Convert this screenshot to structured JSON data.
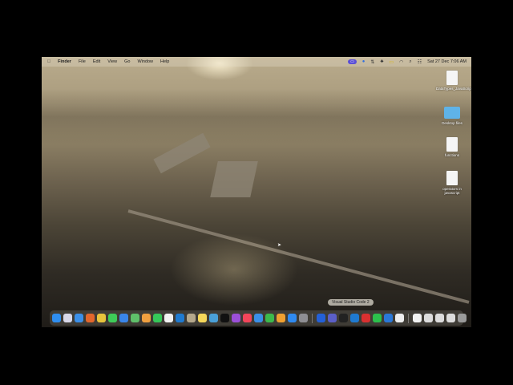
{
  "menubar": {
    "app": "Finder",
    "items": [
      "File",
      "Edit",
      "View",
      "Go",
      "Window",
      "Help"
    ],
    "clock": "Sat 27 Dec  7:06 AM"
  },
  "desktop_icons": [
    {
      "label": "DataTypes_JavaScript_Uhl..._Academy",
      "type": "document"
    },
    {
      "label": "Desktop files",
      "type": "folder"
    },
    {
      "label": "functions",
      "type": "document"
    },
    {
      "label": "operators in javascript",
      "type": "document"
    }
  ],
  "dock": {
    "tooltip": "Visual Studio Code 2",
    "apps": [
      {
        "name": "finder",
        "color": "#2f8ef0"
      },
      {
        "name": "launchpad",
        "color": "#d8d8e8"
      },
      {
        "name": "safari",
        "color": "#3b8fe8"
      },
      {
        "name": "firefox",
        "color": "#e2662c"
      },
      {
        "name": "chrome",
        "color": "#e7c33c"
      },
      {
        "name": "messages",
        "color": "#3ecb58"
      },
      {
        "name": "mail",
        "color": "#3a86ea"
      },
      {
        "name": "maps",
        "color": "#5fbf6a"
      },
      {
        "name": "photos",
        "color": "#f0a040"
      },
      {
        "name": "facetime",
        "color": "#35c759"
      },
      {
        "name": "reminders",
        "color": "#f2f2f2"
      },
      {
        "name": "vscode",
        "color": "#1f7ad0"
      },
      {
        "name": "contacts",
        "color": "#b5a88c"
      },
      {
        "name": "notes",
        "color": "#f5d75a"
      },
      {
        "name": "preview",
        "color": "#4aa0d8"
      },
      {
        "name": "apple-tv",
        "color": "#111111"
      },
      {
        "name": "podcasts",
        "color": "#9b4fd8"
      },
      {
        "name": "music",
        "color": "#f2455a"
      },
      {
        "name": "keynote",
        "color": "#3a8fe8"
      },
      {
        "name": "numbers",
        "color": "#3cba4c"
      },
      {
        "name": "pages",
        "color": "#f0a030"
      },
      {
        "name": "app-store",
        "color": "#2f8af0"
      },
      {
        "name": "system-settings",
        "color": "#8e8e93"
      }
    ],
    "apps2": [
      {
        "name": "blue-app",
        "color": "#2360d8"
      },
      {
        "name": "teams",
        "color": "#5b5fc7"
      },
      {
        "name": "terminal",
        "color": "#222222"
      },
      {
        "name": "vscode-2",
        "color": "#1f7ad0"
      },
      {
        "name": "red-app",
        "color": "#d83030"
      },
      {
        "name": "whatsapp",
        "color": "#2cc04c"
      },
      {
        "name": "quicktime",
        "color": "#2a78d8"
      },
      {
        "name": "textedit",
        "color": "#eeeeee"
      }
    ],
    "others": [
      {
        "name": "document-stack",
        "color": "#f2f2f2"
      },
      {
        "name": "window-thumbnail",
        "color": "#dcdcdc"
      },
      {
        "name": "window-thumbnail",
        "color": "#dcdcdc"
      },
      {
        "name": "window-thumbnail",
        "color": "#dcdcdc"
      },
      {
        "name": "trash",
        "color": "#9a9a9a"
      }
    ]
  }
}
